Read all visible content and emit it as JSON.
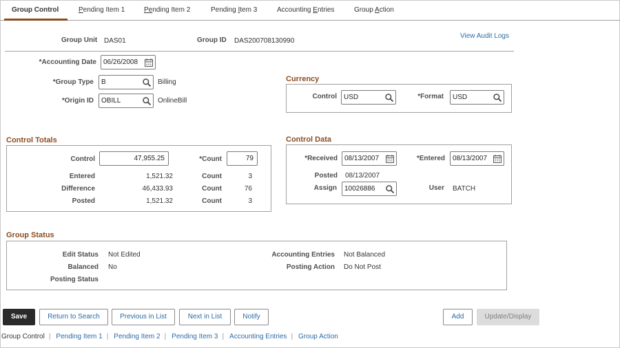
{
  "tabs": [
    {
      "label": "Group Control"
    },
    {
      "label": "Pending Item 1",
      "ak": "P",
      "rest": "ending Item 1"
    },
    {
      "label": "Pending Item 2",
      "ak": "Pe",
      "rest": "nding Item 2"
    },
    {
      "label": "Pending Item 3",
      "pre": "Pending ",
      "ak": "I",
      "rest": "tem 3"
    },
    {
      "label": "Accounting Entries",
      "pre": "Accounting ",
      "ak": "E",
      "rest": "ntries"
    },
    {
      "label": "Group Action",
      "pre": "Group ",
      "ak": "A",
      "rest": "ction"
    }
  ],
  "header": {
    "group_unit_label": "Group Unit",
    "group_unit_value": "DAS01",
    "group_id_label": "Group ID",
    "group_id_value": "DAS200708130990",
    "audit_link": "View Audit Logs"
  },
  "form": {
    "accounting_date_label": "*Accounting Date",
    "accounting_date_value": "06/26/2008",
    "group_type_label": "*Group Type",
    "group_type_value": "B",
    "group_type_desc": "Billing",
    "origin_id_label": "*Origin ID",
    "origin_id_value": "OBILL",
    "origin_id_desc": "OnlineBill"
  },
  "currency": {
    "title": "Currency",
    "control_label": "Control",
    "control_value": "USD",
    "format_label": "*Format",
    "format_value": "USD"
  },
  "control_totals": {
    "title": "Control Totals",
    "control_label": "Control",
    "control_value": "47,955.25",
    "count_label": "*Count",
    "count_value": "79",
    "rows": [
      {
        "label": "Entered",
        "amount": "1,521.32",
        "count_label": "Count",
        "count": "3"
      },
      {
        "label": "Difference",
        "amount": "46,433.93",
        "count_label": "Count",
        "count": "76"
      },
      {
        "label": "Posted",
        "amount": "1,521.32",
        "count_label": "Count",
        "count": "3"
      }
    ]
  },
  "control_data": {
    "title": "Control Data",
    "received_label": "*Received",
    "received_value": "08/13/2007",
    "entered_label": "*Entered",
    "entered_value": "08/13/2007",
    "posted_label": "Posted",
    "posted_value": "08/13/2007",
    "assign_label": "Assign",
    "assign_value": "10026886",
    "user_label": "User",
    "user_value": "BATCH"
  },
  "group_status": {
    "title": "Group Status",
    "edit_status_label": "Edit Status",
    "edit_status_value": "Not Edited",
    "balanced_label": "Balanced",
    "balanced_value": "No",
    "posting_status_label": "Posting Status",
    "posting_status_value": "",
    "accounting_entries_label": "Accounting Entries",
    "accounting_entries_value": "Not Balanced",
    "posting_action_label": "Posting Action",
    "posting_action_value": "Do Not Post"
  },
  "buttons": {
    "save": "Save",
    "return_to_search": "Return to Search",
    "previous_in_list": "Previous in List",
    "next_in_list": "Next in List",
    "notify": "Notify",
    "add": "Add",
    "update_display": "Update/Display"
  },
  "bottom_links": [
    "Group Control",
    "Pending Item 1",
    "Pending Item 2",
    "Pending Item 3",
    "Accounting Entries",
    "Group Action"
  ],
  "icons": {
    "lookup": "magnifier-icon",
    "calendar": "calendar-icon"
  },
  "colors": {
    "accent": "#8c4b1e",
    "link": "#2b6aa5",
    "primary_button": "#2a2a2a"
  }
}
